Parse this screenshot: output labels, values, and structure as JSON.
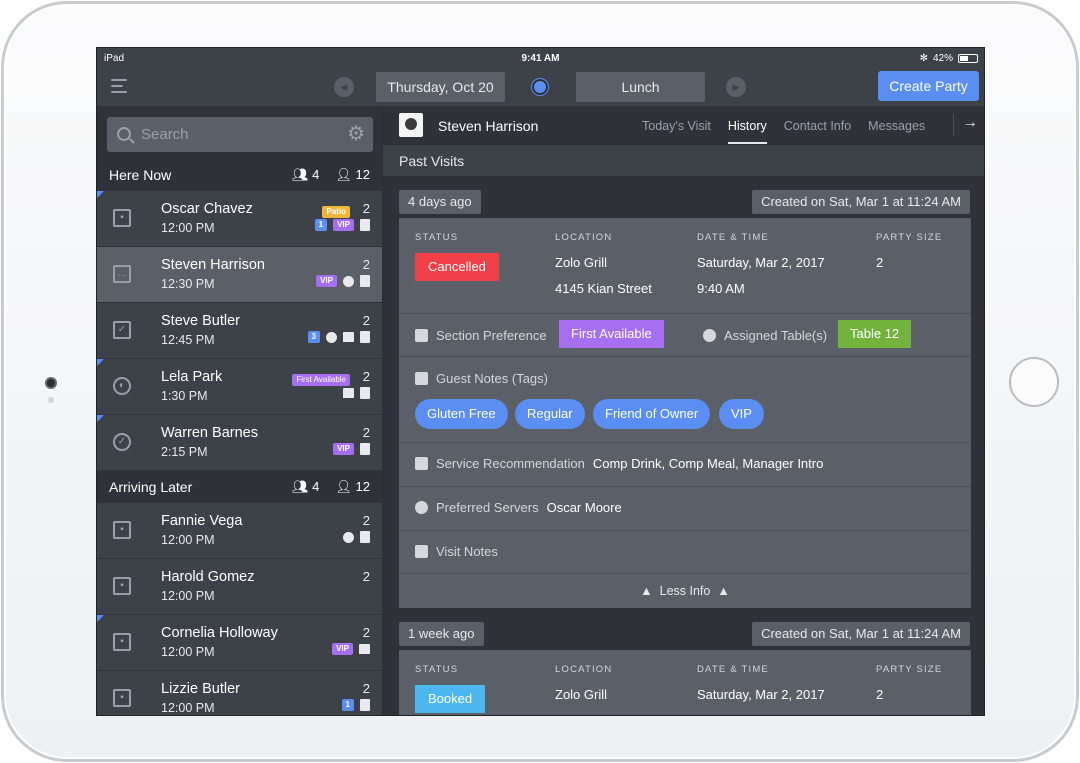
{
  "status_bar": {
    "device": "iPad",
    "time": "9:41 AM",
    "battery": "42%"
  },
  "nav": {
    "date": "Thursday, Oct 20",
    "shift": "Lunch",
    "create_label": "Create Party"
  },
  "colors": {
    "accent": "#5b8ef2",
    "cancelled": "#f2404a",
    "booked": "#4db8f0",
    "vip": "#a66ef0",
    "patio": "#f0b63a",
    "table": "#71b33c"
  },
  "sidebar": {
    "search_placeholder": "Search",
    "here_now": {
      "title": "Here Now",
      "parties": "4",
      "covers": "12"
    },
    "arriving_later": {
      "title": "Arriving Later",
      "parties": "4",
      "covers": "12"
    },
    "here_rows": [
      {
        "name": "Oscar Chavez",
        "time": "12:00 PM",
        "size": "2",
        "top_badge": "Patio",
        "num": "1",
        "icon": "calendar-icon"
      },
      {
        "name": "Steven Harrison",
        "time": "12:30 PM",
        "size": "2",
        "icon": "chat-icon"
      },
      {
        "name": "Steve Butler",
        "time": "12:45 PM",
        "size": "2",
        "num": "3",
        "icon": "check-square-icon"
      },
      {
        "name": "Lela Park",
        "time": "1:30 PM",
        "size": "2",
        "top_badge": "First Available",
        "icon": "half-circle-icon"
      },
      {
        "name": "Warren Barnes",
        "time": "2:15 PM",
        "size": "2",
        "icon": "check-circle-icon"
      }
    ],
    "later_rows": [
      {
        "name": "Fannie Vega",
        "time": "12:00 PM",
        "size": "2",
        "icon": "calendar-icon"
      },
      {
        "name": "Harold Gomez",
        "time": "12:00 PM",
        "size": "2",
        "icon": "calendar-icon"
      },
      {
        "name": "Cornelia Holloway",
        "time": "12:00 PM",
        "size": "2",
        "icon": "calendar-icon"
      },
      {
        "name": "Lizzie Butler",
        "time": "12:00 PM",
        "size": "2",
        "num": "1",
        "icon": "calendar-icon"
      }
    ],
    "vip_label": "VIP"
  },
  "guest": {
    "name": "Steven Harrison",
    "tabs": [
      "Today's Visit",
      "History",
      "Contact Info",
      "Messages"
    ],
    "active_tab": "History"
  },
  "past_visits": {
    "title": "Past Visits",
    "visit1": {
      "ago": "4 days ago",
      "created": "Created on Sat, Mar 1 at 11:24 AM",
      "status_label": "STATUS",
      "status": "Cancelled",
      "location_label": "LOCATION",
      "location_1": "Zolo Grill",
      "location_2": "4145 Kian Street",
      "datetime_label": "DATE & TIME",
      "date": "Saturday, Mar 2, 2017",
      "time": "9:40 AM",
      "party_label": "PARTY SIZE",
      "party": "2",
      "section_pref_label": "Section Preference",
      "section_pref": "First Available",
      "tables_label": "Assigned Table(s)",
      "table": "Table 12",
      "notes_label": "Guest Notes (Tags)",
      "tags": [
        "Gluten Free",
        "Regular",
        "Friend of Owner",
        "VIP"
      ],
      "service_label": "Service Recommendation",
      "service": "Comp Drink, Comp Meal, Manager Intro",
      "servers_label": "Preferred Servers",
      "servers": "Oscar Moore",
      "visit_notes_label": "Visit Notes",
      "less_info": "Less Info"
    },
    "visit2": {
      "ago": "1 week ago",
      "created": "Created on Sat, Mar 1 at 11:24 AM",
      "status_label": "STATUS",
      "status": "Booked",
      "location_label": "LOCATION",
      "location_1": "Zolo Grill",
      "datetime_label": "DATE & TIME",
      "date": "Saturday, Mar 2, 2017",
      "party_label": "PARTY SIZE",
      "party": "2"
    }
  }
}
